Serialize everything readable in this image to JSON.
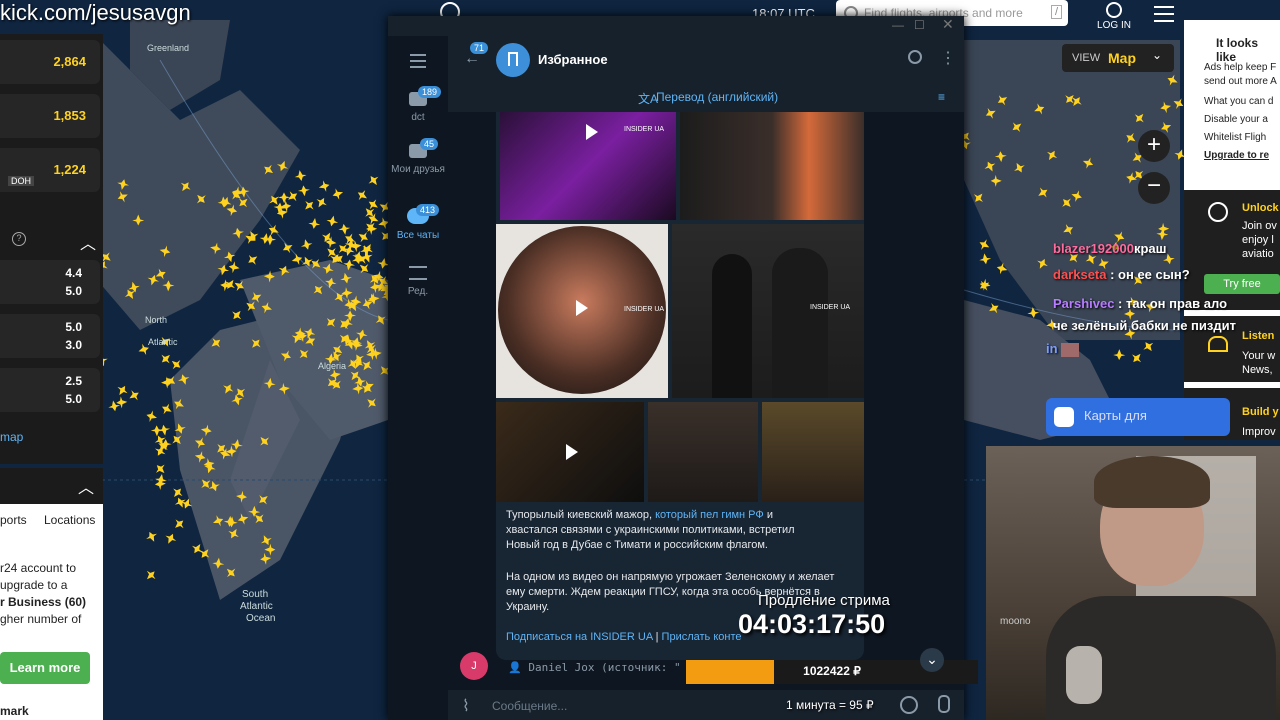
{
  "stream": {
    "url": "kick.com/jesusavgn",
    "extend_label": "Продление стрима",
    "timer": "04:03:17:50",
    "donation_total": "1022422 ₽",
    "rate": "1 минута = 95 ₽",
    "progress_fraction": 0.3
  },
  "flightradar": {
    "logo": "flightradar24",
    "time": "18:07 UTC",
    "search_placeholder": "Find flights, airports and more",
    "search_key": "/",
    "login": "LOG IN",
    "view_label": "VIEW",
    "view_value": "Map",
    "counts": [
      "2,864",
      "1,853",
      "1,224"
    ],
    "airport_code": "DOH",
    "scores": [
      {
        "a": "4.4",
        "b": "5.0"
      },
      {
        "a": "5.0",
        "b": "3.0"
      },
      {
        "a": "2.5",
        "b": "5.0"
      }
    ],
    "map_link": "map",
    "tabs": [
      "ports",
      "Locations"
    ],
    "promo_lines": [
      "r24 account to",
      "upgrade to a",
      "r Business (60)",
      "gher number of"
    ],
    "learn_more": "Learn more",
    "bottom_label": "mark",
    "map_labels": {
      "greenland": "Greenland",
      "north_atlantic": "North\nAtlantic",
      "algeria": "Algeria",
      "south_atlantic": "South\nAtlantic\nOcean"
    },
    "right_panel": {
      "title": "It looks like",
      "line1": "Ads help keep F",
      "line2": "send out more A",
      "line3": "What you can d",
      "b1": "Disable your a",
      "b2": "Whitelist Fligh",
      "b3": "Upgrade to re",
      "unlock": "Unlock",
      "unlock_sub1": "Join ov",
      "unlock_sub2": "enjoy l",
      "unlock_sub3": "aviatio",
      "try_free": "Try free",
      "listen": "Listen",
      "listen_sub1": "Your w",
      "listen_sub2": "News,",
      "build": "Build y",
      "build_sub": "Improv"
    },
    "maps_banner": "Карты для"
  },
  "telegram": {
    "chat_title": "Избранное",
    "back_badge": "71",
    "translate": "Перевод (английский)",
    "folders": [
      {
        "label": "dct",
        "badge": "189"
      },
      {
        "label": "Мои друзья",
        "badge": "45"
      },
      {
        "label": "Все чаты",
        "badge": "413"
      },
      {
        "label": "Ред.",
        "badge": ""
      }
    ],
    "watermark": "INSIDER UA",
    "message_p1_start": "Тупорылый киевский мажор, ",
    "message_p1_link": "который пел гимн РФ",
    "message_p1_end": " и хвастался связями с украинскими политиками, встретил Новый год в Дубае с Тимати и российским флагом.",
    "message_p2": "На одном из видео он напрямую угрожает Зеленскому и желает ему смерти. Ждем реакции ГПСУ, когда эта особь вернётся в Украину.",
    "footer_link1": "Подписаться на INSIDER UA",
    "footer_sep": "|",
    "footer_link2": "Прислать конте",
    "forward_line": "Daniel Jox (источник: \"",
    "avatar_letter": "J",
    "input_placeholder": "Сообщение..."
  },
  "chat": [
    {
      "user": "blazer192000",
      "color": "#ff6b9d",
      "text": "краш"
    },
    {
      "user": "darkseta",
      "color": "#ff5050",
      "text": "он ее сын?"
    },
    {
      "user": "Parshivec",
      "color": "#b77cff",
      "text": "так он прав ало че зелёный бабки не пиздит"
    },
    {
      "user": "in",
      "color": "#7c9cff",
      "text": ""
    }
  ],
  "webcam_mic_label": "moono"
}
